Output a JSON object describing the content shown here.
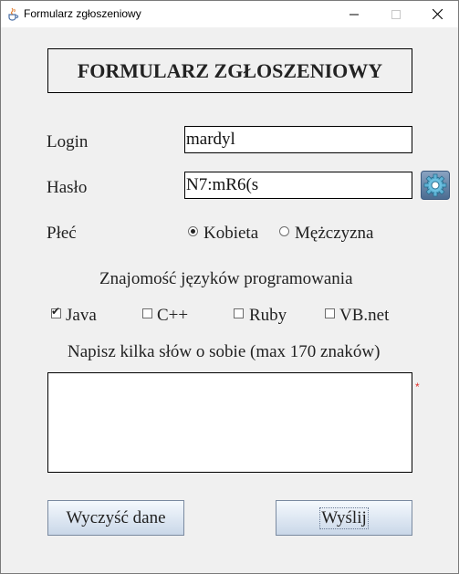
{
  "window": {
    "title": "Formularz zgłoszeniowy"
  },
  "form": {
    "header": "FORMULARZ ZGŁOSZENIOWY",
    "login_label": "Login",
    "login_value": "mardyl",
    "password_label": "Hasło",
    "password_value": "N7:mR6(s",
    "gender_label": "Płeć",
    "gender_options": [
      {
        "label": "Kobieta",
        "selected": true
      },
      {
        "label": "Mężczyzna",
        "selected": false
      }
    ],
    "languages_heading": "Znajomość języków programowania",
    "languages": [
      {
        "label": "Java",
        "checked": true
      },
      {
        "label": "C++",
        "checked": false
      },
      {
        "label": "Ruby",
        "checked": false
      },
      {
        "label": "VB.net",
        "checked": false
      }
    ],
    "about_label": "Napisz kilka słów o sobie (max 170 znaków)",
    "about_value": "",
    "required_marker": "*",
    "clear_button": "Wyczyść dane",
    "send_button": "Wyślij"
  },
  "icons": {
    "app": "java-cup-icon",
    "generate_password": "gear-icon"
  },
  "colors": {
    "window_bg": "#f0f0f0",
    "button_gradient_top": "#f5f9fd",
    "button_gradient_bottom": "#c9d7e8",
    "required_marker": "#e0302a",
    "gear_icon": "#3f8db0"
  }
}
